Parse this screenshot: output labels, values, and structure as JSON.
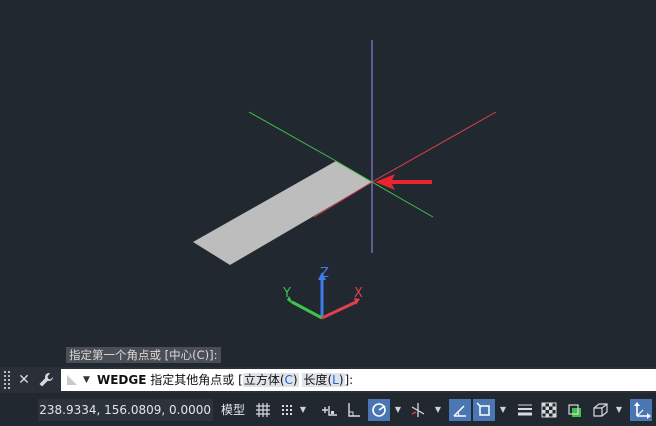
{
  "viewport": {
    "axis_labels": {
      "x": "X",
      "y": "Y",
      "z": "Z"
    }
  },
  "command_history": "指定第一个角点或 [中心(C)]:",
  "command_line": {
    "command": "WEDGE",
    "prompt": "指定其他角点或",
    "bracket_open": "[",
    "option1_label": "立方体",
    "option1_key": "C",
    "option2_label": "长度",
    "option2_key": "L",
    "bracket_close": "]:"
  },
  "status_bar": {
    "coordinates": "238.9334, 156.0809, 0.0000",
    "model_label": "模型"
  },
  "colors": {
    "background": "#212830",
    "axis_x": "#e0404a",
    "axis_y": "#3ec24a",
    "axis_z": "#3d7de8",
    "crosshair_z": "#9b8ff0",
    "accent": "#4a77b4"
  },
  "icons": [
    "close-icon",
    "wrench-icon",
    "grid-icon",
    "snap-icon",
    "ortho-icon",
    "polar-icon",
    "osnap-icon",
    "dynamic-ucs-icon",
    "lineweight-icon",
    "transparency-icon",
    "selection-cycling-icon",
    "annotation-scale-icon",
    "ucs-icon"
  ]
}
